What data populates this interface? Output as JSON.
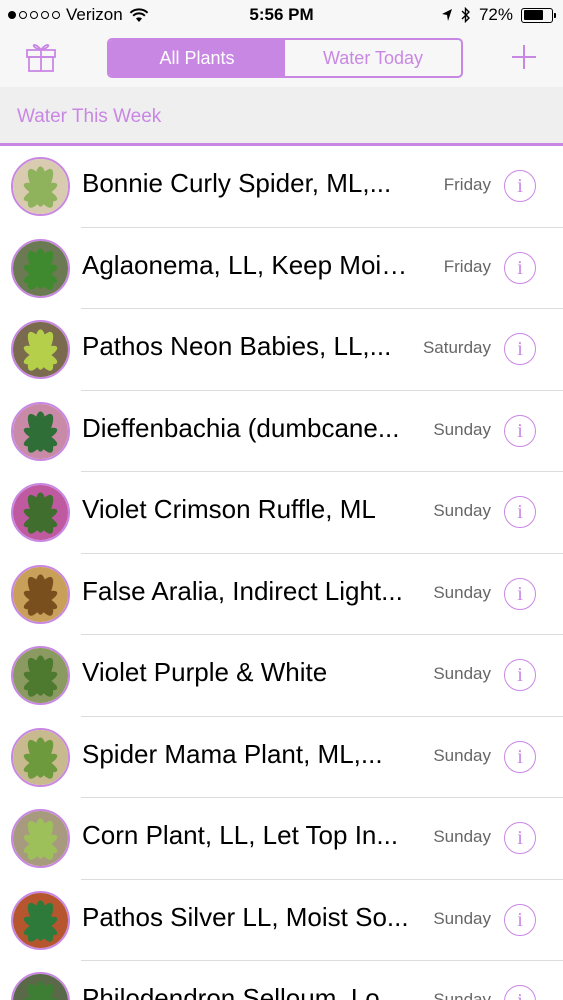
{
  "status_bar": {
    "carrier": "Verizon",
    "time": "5:56 PM",
    "battery": "72%",
    "battery_level": 0.72,
    "signal_bars_filled": 1,
    "signal_bars_total": 5
  },
  "nav": {
    "left_icon": "gift-icon",
    "segments": [
      {
        "label": "All Plants",
        "active": true
      },
      {
        "label": "Water Today",
        "active": false
      }
    ],
    "right_icon": "plus-icon"
  },
  "section": {
    "title": "Water This Week"
  },
  "plants": [
    {
      "name": "Bonnie Curly Spider, ML,...",
      "day": "Friday",
      "thumb_color": "#8fb35c",
      "thumb_bg": "#d9cbb0"
    },
    {
      "name": "Aglaonema, LL, Keep Mois...",
      "day": "Friday",
      "thumb_color": "#3f8a2e",
      "thumb_bg": "#6b7a52"
    },
    {
      "name": "Pathos Neon Babies, LL,...",
      "day": "Saturday",
      "thumb_color": "#b5cf4a",
      "thumb_bg": "#7a6a4e"
    },
    {
      "name": "Dieffenbachia (dumbcane...",
      "day": "Sunday",
      "thumb_color": "#2f6e36",
      "thumb_bg": "#c98aa8"
    },
    {
      "name": "Violet Crimson Ruffle, ML",
      "day": "Sunday",
      "thumb_color": "#3f6e2e",
      "thumb_bg": "#c05aa0"
    },
    {
      "name": "False Aralia, Indirect Light...",
      "day": "Sunday",
      "thumb_color": "#7a4f1e",
      "thumb_bg": "#c8a05a"
    },
    {
      "name": "Violet Purple & White",
      "day": "Sunday",
      "thumb_color": "#4e7a30",
      "thumb_bg": "#8a9a60"
    },
    {
      "name": "Spider Mama Plant, ML,...",
      "day": "Sunday",
      "thumb_color": "#6e9a3e",
      "thumb_bg": "#c9b98e"
    },
    {
      "name": "Corn Plant, LL, Let Top In...",
      "day": "Sunday",
      "thumb_color": "#9ec05a",
      "thumb_bg": "#a89a7e"
    },
    {
      "name": "Pathos Silver LL, Moist So...",
      "day": "Sunday",
      "thumb_color": "#2e7a3a",
      "thumb_bg": "#b5562e"
    },
    {
      "name": "Philodendron Selloum, Lo...",
      "day": "Sunday",
      "thumb_color": "#3e7e34",
      "thumb_bg": "#5a6a48"
    }
  ],
  "colors": {
    "accent": "#c987e4",
    "bar_background": "#f7f7f7",
    "section_background": "#efefef",
    "separator": "#dcdcdc"
  }
}
